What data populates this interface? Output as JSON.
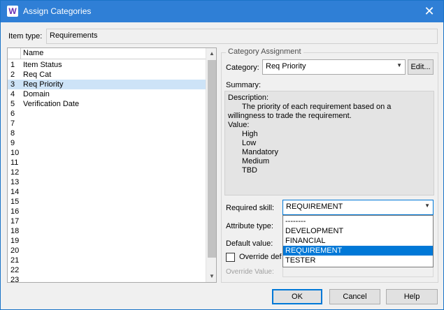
{
  "window": {
    "title": "Assign Categories",
    "app_icon_letter": "W"
  },
  "item_type": {
    "label": "Item type:",
    "value": "Requirements"
  },
  "list": {
    "header": "Name",
    "rows": [
      {
        "num": "1",
        "name": "Item Status"
      },
      {
        "num": "2",
        "name": "Req Cat"
      },
      {
        "num": "3",
        "name": "Req Priority"
      },
      {
        "num": "4",
        "name": "Domain"
      },
      {
        "num": "5",
        "name": "Verification Date"
      },
      {
        "num": "6",
        "name": ""
      },
      {
        "num": "7",
        "name": ""
      },
      {
        "num": "8",
        "name": ""
      },
      {
        "num": "9",
        "name": ""
      },
      {
        "num": "10",
        "name": ""
      },
      {
        "num": "11",
        "name": ""
      },
      {
        "num": "12",
        "name": ""
      },
      {
        "num": "13",
        "name": ""
      },
      {
        "num": "14",
        "name": ""
      },
      {
        "num": "15",
        "name": ""
      },
      {
        "num": "16",
        "name": ""
      },
      {
        "num": "17",
        "name": ""
      },
      {
        "num": "18",
        "name": ""
      },
      {
        "num": "19",
        "name": ""
      },
      {
        "num": "20",
        "name": ""
      },
      {
        "num": "21",
        "name": ""
      },
      {
        "num": "22",
        "name": ""
      },
      {
        "num": "23",
        "name": ""
      }
    ],
    "selected_index": 2
  },
  "category_assignment": {
    "group_title": "Category Assignment",
    "category_label": "Category:",
    "category_value": "Req Priority",
    "edit_button": "Edit...",
    "summary_label": "Summary:",
    "summary": {
      "description_label": "Description:",
      "description_line1": "The priority of each requirement based on a",
      "description_line2": "willingness to trade the requirement.",
      "value_label": "Value:",
      "values": [
        "High",
        "Low",
        "Mandatory",
        "Medium",
        "TBD"
      ]
    },
    "required_skill_label": "Required skill:",
    "required_skill_value": "REQUIREMENT",
    "required_skill_options": [
      "--------",
      "DEVELOPMENT",
      "FINANCIAL",
      "REQUIREMENT",
      "TESTER"
    ],
    "required_skill_selected_index": 3,
    "attribute_type_label": "Attribute type:",
    "default_value_label": "Default value:",
    "override_checkbox_label": "Override def",
    "override_value_label": "Override Value:"
  },
  "buttons": {
    "ok": "OK",
    "cancel": "Cancel",
    "help": "Help"
  },
  "colors": {
    "titlebar": "#2f7fd6",
    "selection": "#0078d7",
    "list_selection": "#cde3f7"
  }
}
